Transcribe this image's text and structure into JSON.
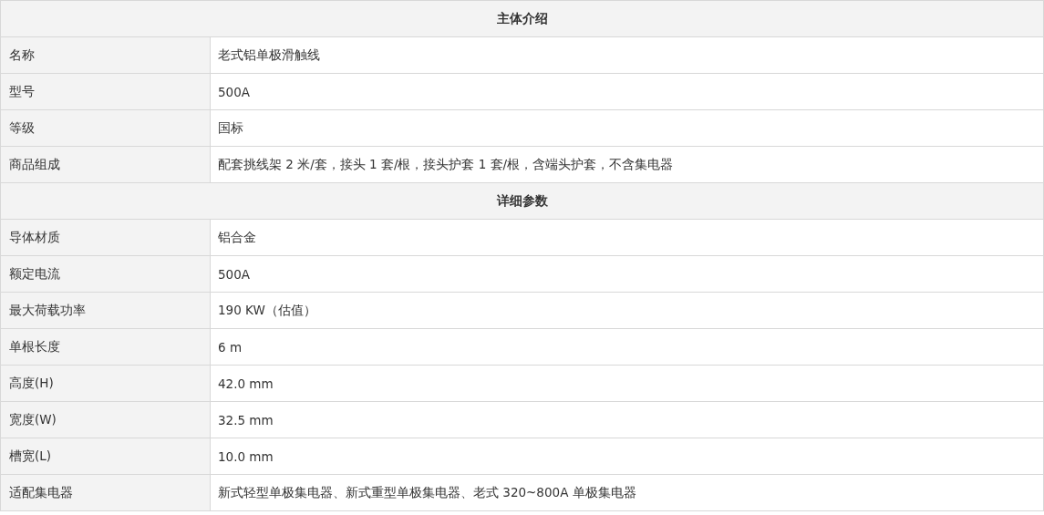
{
  "sections": [
    {
      "title": "主体介绍",
      "rows": [
        {
          "label": "名称",
          "value": "老式铝单极滑触线"
        },
        {
          "label": "型号",
          "value": "500A"
        },
        {
          "label": "等级",
          "value": "国标"
        },
        {
          "label": "商品组成",
          "value": "配套挑线架 2 米/套，接头 1 套/根，接头护套 1 套/根，含端头护套，不含集电器"
        }
      ]
    },
    {
      "title": "详细参数",
      "rows": [
        {
          "label": "导体材质",
          "value": "铝合金"
        },
        {
          "label": "额定电流",
          "value": "500A"
        },
        {
          "label": "最大荷载功率",
          "value": "190 KW（估值）"
        },
        {
          "label": "单根长度",
          "value": "6 m"
        },
        {
          "label": "高度(H)",
          "value": "42.0 mm"
        },
        {
          "label": "宽度(W)",
          "value": "32.5 mm"
        },
        {
          "label": "槽宽(L)",
          "value": "10.0 mm"
        },
        {
          "label": "适配集电器",
          "value": "新式轻型单极集电器、新式重型单极集电器、老式 320~800A 单极集电器"
        }
      ]
    }
  ]
}
